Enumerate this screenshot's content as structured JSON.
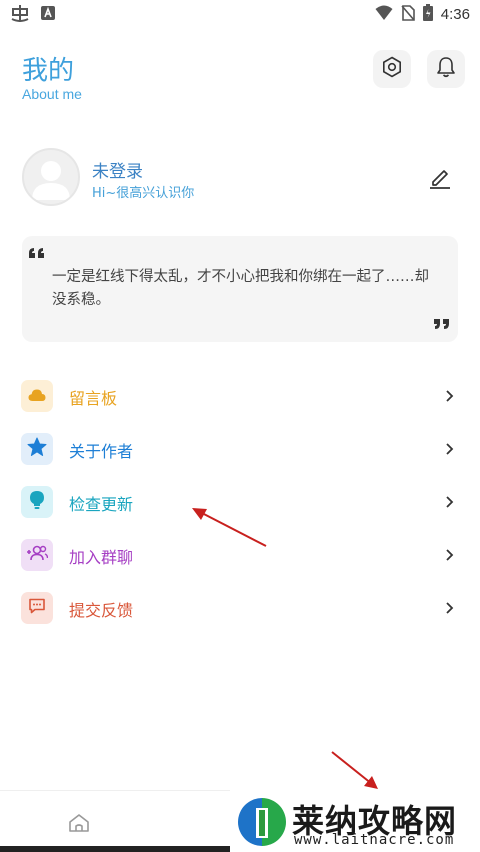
{
  "status_bar": {
    "time": "4:36",
    "icons": [
      "app-icon",
      "a-icon",
      "wifi-icon",
      "no-sim-icon",
      "battery-icon"
    ]
  },
  "header": {
    "title": "我的",
    "subtitle": "About me",
    "icons": [
      "settings-icon",
      "bell-icon"
    ]
  },
  "profile": {
    "name": "未登录",
    "greeting": "Hi~很高兴认识你",
    "edit_icon": "edit-icon"
  },
  "quote": {
    "text": "一定是红线下得太乱，才不小心把我和你绑在一起了……却没系稳。"
  },
  "menu": {
    "items": [
      {
        "label": "留言板",
        "icon": "cloud-icon",
        "color": "#e8a321",
        "bg": "#fdefd6"
      },
      {
        "label": "关于作者",
        "icon": "star-icon",
        "color": "#1e7fd6",
        "bg": "#e2eefa"
      },
      {
        "label": "检查更新",
        "icon": "bulb-icon",
        "color": "#1aa5bf",
        "bg": "#d9f3f8"
      },
      {
        "label": "加入群聊",
        "icon": "group-icon",
        "color": "#a63fc4",
        "bg": "#f0dff6"
      },
      {
        "label": "提交反馈",
        "icon": "feedback-icon",
        "color": "#d9573a",
        "bg": "#fbe2dc"
      }
    ]
  },
  "bottom_nav": {
    "items": [
      "home-icon"
    ]
  },
  "watermark": {
    "title": "莱纳攻略网",
    "url": "www.laitnacre.com"
  }
}
